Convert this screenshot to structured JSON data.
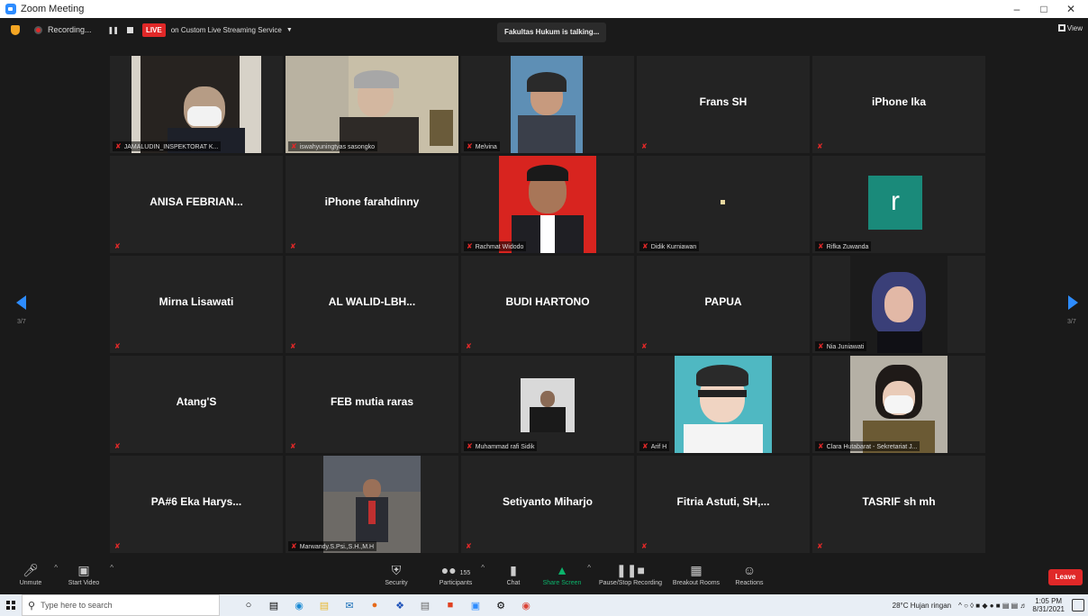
{
  "window": {
    "title": "Zoom Meeting",
    "minimize": "–",
    "restore": "□",
    "close": "✕"
  },
  "topbar": {
    "recording_label": "Recording...",
    "live_badge": "LIVE",
    "stream_label": "on Custom Live Streaming Service",
    "talking": "Fakultas Hukum is talking...",
    "view_label": "View"
  },
  "pagination": {
    "left": "3/7",
    "right": "3/7"
  },
  "tiles": [
    {
      "name": "JAMALUDIN_INSPEKTORAT K...",
      "kind": "video"
    },
    {
      "name": "iswahyuningtyas sasongko",
      "kind": "video"
    },
    {
      "name": "Melvina",
      "kind": "video"
    },
    {
      "name": "Frans SH",
      "kind": "name"
    },
    {
      "name": "iPhone Ika",
      "kind": "name"
    },
    {
      "name": "ANISA FEBRIAN...",
      "kind": "name"
    },
    {
      "name": "iPhone farahdinny",
      "kind": "name"
    },
    {
      "name": "Rachmat Widodo",
      "kind": "video"
    },
    {
      "name": "Didik Kurniawan",
      "kind": "video"
    },
    {
      "name": "Rifka Zuwanda",
      "kind": "avatar",
      "initial": "r"
    },
    {
      "name": "Mirna Lisawati",
      "kind": "name"
    },
    {
      "name": "AL WALID-LBH...",
      "kind": "name"
    },
    {
      "name": "BUDI HARTONO",
      "kind": "name"
    },
    {
      "name": "PAPUA",
      "kind": "name"
    },
    {
      "name": "Nia Juniawati",
      "kind": "video"
    },
    {
      "name": "Atang'S",
      "kind": "name"
    },
    {
      "name": "FEB mutia raras",
      "kind": "name"
    },
    {
      "name": "Muhammad rafi Sidik",
      "kind": "video"
    },
    {
      "name": "Arif H",
      "kind": "video"
    },
    {
      "name": "Clara Hutabarat - Sekretariat J...",
      "kind": "video"
    },
    {
      "name": "PA#6 Eka Harys...",
      "kind": "name"
    },
    {
      "name": "Marwandy.S.Psi.,S.H.,M.H",
      "kind": "video"
    },
    {
      "name": "Setiyanto Miharjo",
      "kind": "name"
    },
    {
      "name": "Fitria Astuti, SH,...",
      "kind": "name"
    },
    {
      "name": "TASRIF sh mh",
      "kind": "name"
    }
  ],
  "controls": {
    "unmute": "Unmute",
    "start_video": "Start Video",
    "security": "Security",
    "participants": "Participants",
    "participants_count": "155",
    "chat": "Chat",
    "share_screen": "Share Screen",
    "pause_stop": "Pause/Stop Recording",
    "breakout": "Breakout Rooms",
    "reactions": "Reactions",
    "leave": "Leave"
  },
  "taskbar": {
    "search_placeholder": "Type here to search",
    "weather": "28°C  Hujan ringan",
    "time": "1:05 PM",
    "date": "8/31/2021"
  },
  "colors": {
    "accent": "#2d8cff",
    "live_red": "#e02828",
    "share_green": "#0bb36b",
    "tile_bg": "#232323"
  }
}
